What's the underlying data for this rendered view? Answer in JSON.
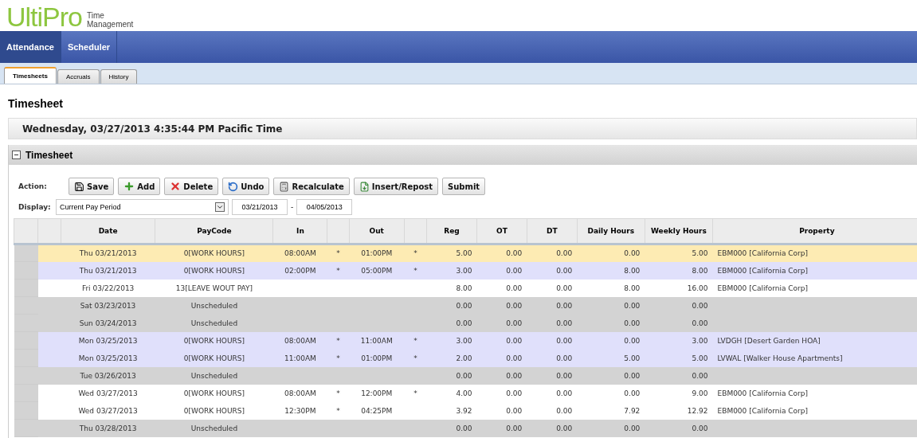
{
  "logo": {
    "brand": "UltiPro",
    "product_line1": "Time",
    "product_line2": "Management"
  },
  "nav": [
    {
      "label": "Attendance",
      "selected": true
    },
    {
      "label": "Scheduler",
      "selected": false
    }
  ],
  "subtabs": [
    {
      "label": "Timesheets",
      "selected": true
    },
    {
      "label": "Accruals",
      "selected": false
    },
    {
      "label": "History",
      "selected": false
    }
  ],
  "page_title": "Timesheet",
  "datetime": "Wednesday, 03/27/2013 4:35:44 PM Pacific Time",
  "section": {
    "title": "Timesheet",
    "expanded": true
  },
  "action_label": "Action:",
  "buttons": [
    {
      "label": "Save",
      "kind": "save"
    },
    {
      "label": "Add",
      "kind": "add"
    },
    {
      "label": "Delete",
      "kind": "delete"
    },
    {
      "label": "Undo",
      "kind": "undo"
    },
    {
      "label": "Recalculate",
      "kind": "recalculate"
    },
    {
      "label": "Insert/Repost",
      "kind": "insert"
    },
    {
      "label": "Submit",
      "kind": "submit"
    }
  ],
  "display": {
    "label": "Display:",
    "value": "Current Pay Period",
    "from": "03/21/2013",
    "separator": "-",
    "to": "04/05/2013"
  },
  "table": {
    "columns": [
      "",
      "",
      "Date",
      "PayCode",
      "In",
      "",
      "Out",
      "",
      "Reg",
      "OT",
      "DT",
      "Daily Hours",
      "Weekly Hours",
      "Property"
    ],
    "rows": [
      {
        "selected": true,
        "kind": "split",
        "date": "Thu 03/21/2013",
        "paycode": "0[WORK HOURS]",
        "in": "08:00AM",
        "in_mark": "*",
        "out": "01:00PM",
        "out_mark": "*",
        "reg": "5.00",
        "ot": "0.00",
        "dt": "0.00",
        "daily": "0.00",
        "weekly": "5.00",
        "property": "EBM000 [California Corp]"
      },
      {
        "selected": false,
        "kind": "split",
        "date": "Thu 03/21/2013",
        "paycode": "0[WORK HOURS]",
        "in": "02:00PM",
        "in_mark": "*",
        "out": "05:00PM",
        "out_mark": "*",
        "reg": "3.00",
        "ot": "0.00",
        "dt": "0.00",
        "daily": "8.00",
        "weekly": "8.00",
        "property": "EBM000 [California Corp]"
      },
      {
        "selected": false,
        "kind": "single",
        "date": "Fri 03/22/2013",
        "paycode": "13[LEAVE WOUT PAY]",
        "reg": "8.00",
        "ot": "0.00",
        "dt": "0.00",
        "daily": "8.00",
        "weekly": "16.00",
        "property": "EBM000 [California Corp]"
      },
      {
        "selected": false,
        "kind": "unscheduled",
        "date": "Sat 03/23/2013",
        "paycode": "Unscheduled",
        "reg": "0.00",
        "ot": "0.00",
        "dt": "0.00",
        "daily": "0.00",
        "weekly": "0.00"
      },
      {
        "selected": false,
        "kind": "unscheduled",
        "date": "Sun 03/24/2013",
        "paycode": "Unscheduled",
        "reg": "0.00",
        "ot": "0.00",
        "dt": "0.00",
        "daily": "0.00",
        "weekly": "0.00"
      },
      {
        "selected": false,
        "kind": "split",
        "date": "Mon 03/25/2013",
        "paycode": "0[WORK HOURS]",
        "in": "08:00AM",
        "in_mark": "*",
        "out": "11:00AM",
        "out_mark": "*",
        "reg": "3.00",
        "ot": "0.00",
        "dt": "0.00",
        "daily": "0.00",
        "weekly": "3.00",
        "property": "LVDGH [Desert Garden HOA]"
      },
      {
        "selected": false,
        "kind": "split",
        "date": "Mon 03/25/2013",
        "paycode": "0[WORK HOURS]",
        "in": "11:00AM",
        "in_mark": "*",
        "out": "01:00PM",
        "out_mark": "*",
        "reg": "2.00",
        "ot": "0.00",
        "dt": "0.00",
        "daily": "5.00",
        "weekly": "5.00",
        "property": "LVWAL [Walker House Apartments]"
      },
      {
        "selected": false,
        "kind": "unscheduled",
        "date": "Tue 03/26/2013",
        "paycode": "Unscheduled",
        "reg": "0.00",
        "ot": "0.00",
        "dt": "0.00",
        "daily": "0.00",
        "weekly": "0.00"
      },
      {
        "selected": false,
        "kind": "single",
        "date": "Wed 03/27/2013",
        "paycode": "0[WORK HOURS]",
        "in": "08:00AM",
        "in_mark": "*",
        "out": "12:00PM",
        "out_mark": "*",
        "reg": "4.00",
        "ot": "0.00",
        "dt": "0.00",
        "daily": "0.00",
        "weekly": "9.00",
        "property": "EBM000 [California Corp]"
      },
      {
        "selected": false,
        "kind": "single",
        "date": "Wed 03/27/2013",
        "paycode": "0[WORK HOURS]",
        "in": "12:30PM",
        "in_mark": "*",
        "out": "04:25PM",
        "reg": "3.92",
        "ot": "0.00",
        "dt": "0.00",
        "daily": "7.92",
        "weekly": "12.92",
        "property": "EBM000 [California Corp]"
      },
      {
        "selected": false,
        "kind": "unscheduled",
        "date": "Thu 03/28/2013",
        "paycode": "Unscheduled",
        "reg": "0.00",
        "ot": "0.00",
        "dt": "0.00",
        "daily": "0.00",
        "weekly": "0.00"
      }
    ]
  }
}
